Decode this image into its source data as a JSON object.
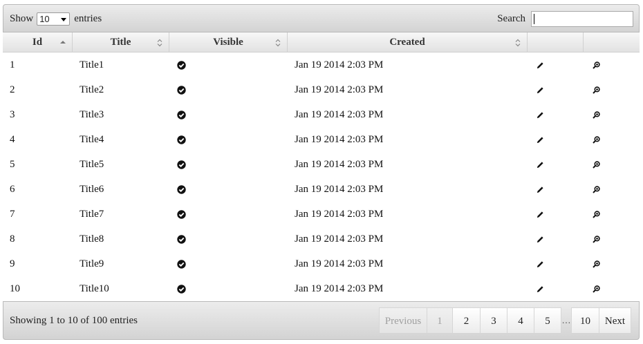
{
  "toolbar": {
    "show_label": "Show",
    "page_length": "10",
    "entries_label": "entries",
    "search_label": "Search",
    "search_value": ""
  },
  "columns": [
    {
      "label": "Id",
      "sort": "asc"
    },
    {
      "label": "Title",
      "sort": "both"
    },
    {
      "label": "Visible",
      "sort": "both"
    },
    {
      "label": "Created",
      "sort": "both"
    },
    {
      "label": "",
      "sort": "none"
    },
    {
      "label": "",
      "sort": "none"
    }
  ],
  "rows": [
    {
      "id": "1",
      "title": "Title1",
      "visible": "check-circle-icon",
      "created": "Jan 19 2014 2:03 PM"
    },
    {
      "id": "2",
      "title": "Title2",
      "visible": "check-circle-icon",
      "created": "Jan 19 2014 2:03 PM"
    },
    {
      "id": "3",
      "title": "Title3",
      "visible": "check-circle-icon",
      "created": "Jan 19 2014 2:03 PM"
    },
    {
      "id": "4",
      "title": "Title4",
      "visible": "check-circle-icon",
      "created": "Jan 19 2014 2:03 PM"
    },
    {
      "id": "5",
      "title": "Title5",
      "visible": "check-circle-icon",
      "created": "Jan 19 2014 2:03 PM"
    },
    {
      "id": "6",
      "title": "Title6",
      "visible": "check-circle-icon",
      "created": "Jan 19 2014 2:03 PM"
    },
    {
      "id": "7",
      "title": "Title7",
      "visible": "check-circle-icon",
      "created": "Jan 19 2014 2:03 PM"
    },
    {
      "id": "8",
      "title": "Title8",
      "visible": "check-circle-icon",
      "created": "Jan 19 2014 2:03 PM"
    },
    {
      "id": "9",
      "title": "Title9",
      "visible": "check-circle-icon",
      "created": "Jan 19 2014 2:03 PM"
    },
    {
      "id": "10",
      "title": "Title10",
      "visible": "check-circle-icon",
      "created": "Jan 19 2014 2:03 PM"
    }
  ],
  "row_actions": {
    "edit_icon": "pencil-icon",
    "view_icon": "zoom-icon"
  },
  "footer": {
    "info": "Showing 1 to 10 of 100 entries",
    "previous": "Previous",
    "pages": [
      "1",
      "2",
      "3",
      "4",
      "5"
    ],
    "ellipsis": "…",
    "last_page": "10",
    "next": "Next",
    "current_page": "1"
  }
}
